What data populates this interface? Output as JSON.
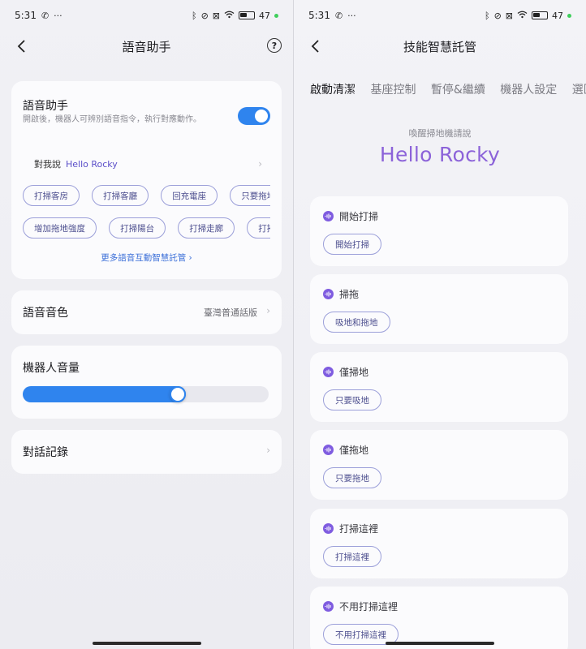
{
  "left": {
    "status": {
      "time": "5:31",
      "battery": "47"
    },
    "header": {
      "title": "語音助手",
      "help_symbol": "?"
    },
    "voice_card": {
      "title": "語音助手",
      "description": "開啟後，機器人可辨別語音指令，執行對應動作。",
      "toggle_on": true,
      "say_prefix": "對我說",
      "say_name": "Hello Rocky",
      "chips_row1": [
        "打掃客房",
        "打掃客廳",
        "回充電座",
        "只要拖地"
      ],
      "chips_row2": [
        "增加拖地強度",
        "打掃陽台",
        "打掃走廊",
        "打掃"
      ],
      "more_link": "更多語音互動智慧託管 ›"
    },
    "tone_card": {
      "label": "語音音色",
      "value": "臺灣普通話版"
    },
    "volume_card": {
      "label": "機器人音量",
      "level": 0.63
    },
    "history_card": {
      "label": "對話記錄"
    }
  },
  "right": {
    "status": {
      "time": "5:31",
      "battery": "47"
    },
    "header": {
      "title": "技能智慧託管"
    },
    "tabs": [
      "啟動清潔",
      "基座控制",
      "暫停&繼續",
      "機器人設定",
      "選區"
    ],
    "active_tab": 0,
    "wake_hint": "喚醒掃地機請說",
    "wake_phrase": "Hello Rocky",
    "skills": [
      {
        "title": "開始打掃",
        "command": "開始打掃"
      },
      {
        "title": "掃拖",
        "command": "吸地和拖地"
      },
      {
        "title": "僅掃地",
        "command": "只要吸地"
      },
      {
        "title": "僅拖地",
        "command": "只要拖地"
      },
      {
        "title": "打掃這裡",
        "command": "打掃這裡"
      },
      {
        "title": "不用打掃這裡",
        "command": "不用打掃這裡"
      }
    ]
  },
  "colors": {
    "accent_blue": "#2f84ee",
    "accent_purple": "#8c63d9",
    "chip_border": "#9b9fd9"
  }
}
